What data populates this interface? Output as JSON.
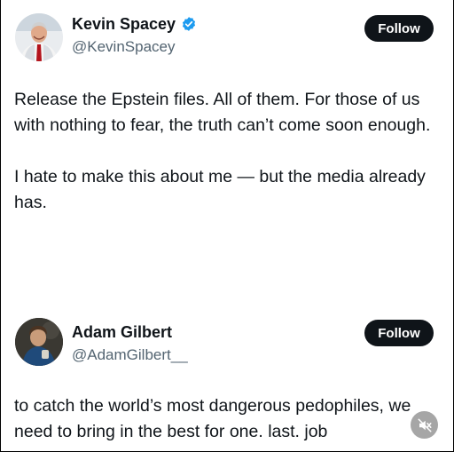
{
  "tweets": [
    {
      "display_name": "Kevin Spacey",
      "handle": "@KevinSpacey",
      "verified": true,
      "follow_label": "Follow",
      "paragraphs": [
        "Release the Epstein files. All of them. For those of us with nothing to fear, the truth can’t come soon enough.",
        "I hate to make this about me — but the media already has."
      ],
      "avatar_icon": "profile-photo"
    },
    {
      "display_name": "Adam Gilbert",
      "handle": "@AdamGilbert__",
      "verified": false,
      "follow_label": "Follow",
      "paragraphs": [
        "to catch the world’s most dangerous pedophiles, we need to bring in the best for one. last. job"
      ],
      "avatar_icon": "profile-photo"
    }
  ],
  "overlay": {
    "mute_icon": "speaker-muted-icon"
  },
  "colors": {
    "text": "#0f1419",
    "handle": "#536471",
    "follow_bg": "#0f1419",
    "verified": "#1d9bf0"
  }
}
